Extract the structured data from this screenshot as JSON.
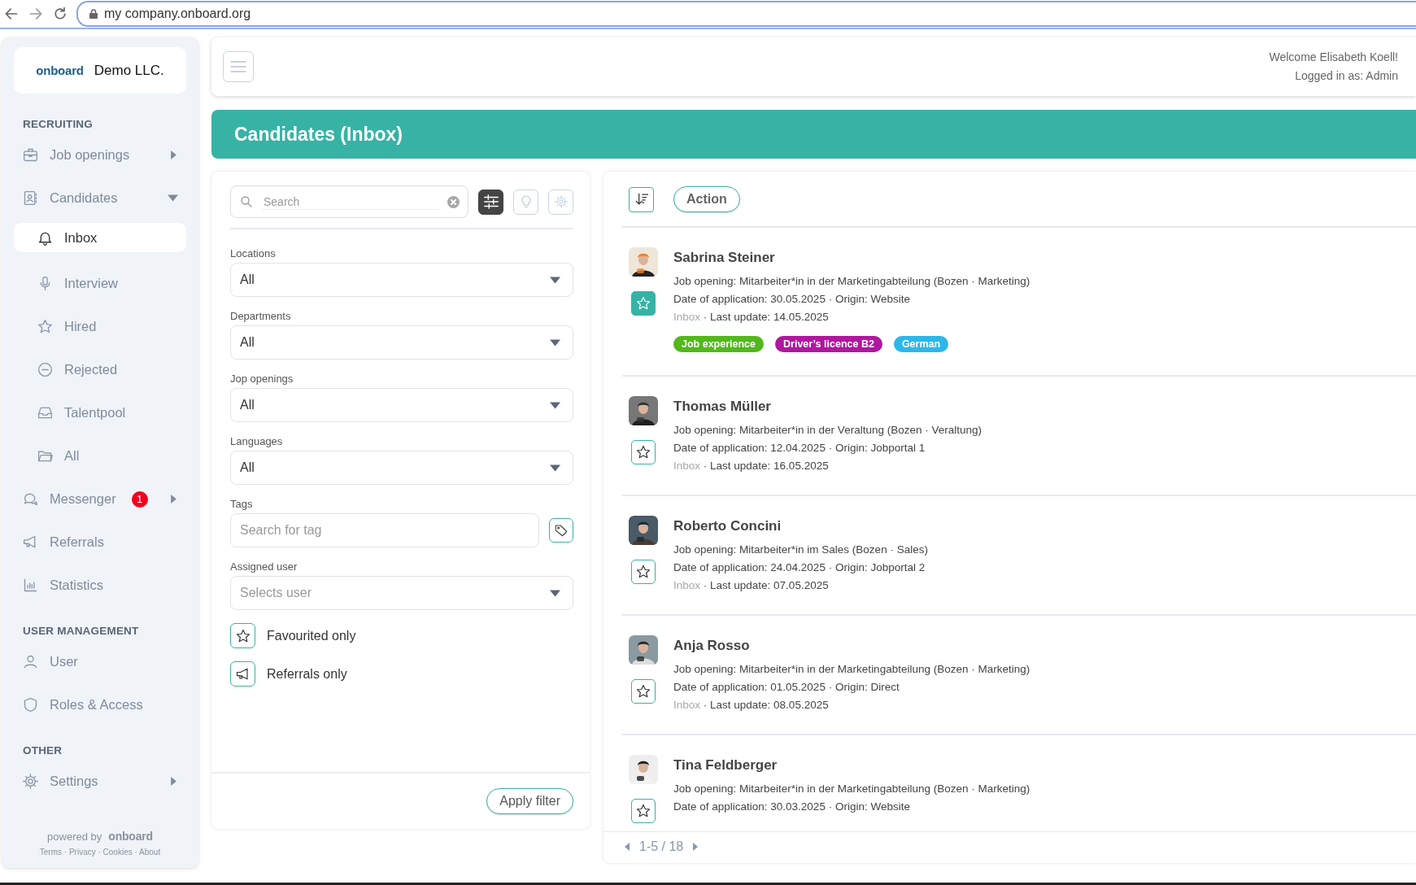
{
  "browser": {
    "url": "my company.onboard.org"
  },
  "sidebar": {
    "logo": "onboard",
    "company": "Demo LLC.",
    "sections": [
      {
        "title": "RECRUITING",
        "items": [
          {
            "label": "Job openings",
            "selected": false,
            "expanded": false
          },
          {
            "label": "Candidates",
            "selected": false,
            "expanded": true,
            "children": [
              {
                "label": "Inbox",
                "selected": true
              },
              {
                "label": "Interview",
                "selected": false
              },
              {
                "label": "Hired",
                "selected": false
              },
              {
                "label": "Rejected",
                "selected": false
              },
              {
                "label": "Talentpool",
                "selected": false
              },
              {
                "label": "All",
                "selected": false
              }
            ]
          },
          {
            "label": "Messenger",
            "selected": false,
            "expanded": false,
            "badge": "1"
          },
          {
            "label": "Referrals",
            "selected": false
          },
          {
            "label": "Statistics",
            "selected": false
          }
        ]
      },
      {
        "title": "USER MANAGEMENT",
        "items": [
          {
            "label": "User",
            "selected": false
          },
          {
            "label": "Roles & Access",
            "selected": false
          }
        ]
      },
      {
        "title": "OTHER",
        "items": [
          {
            "label": "Settings",
            "selected": false,
            "expanded": false
          }
        ]
      }
    ],
    "footer": {
      "powered_by": "powered by",
      "logo": "onboard",
      "links": "Terms · Privacy · Cookies · About"
    }
  },
  "header": {
    "welcome": "Welcome Elisabeth Koell!",
    "role": "Logged in as: Admin"
  },
  "page_title": "Candidates (Inbox)",
  "filters": {
    "search": {
      "placeholder": "Search"
    },
    "filters_open": true,
    "fields": [
      {
        "kind": "select",
        "label": "Locations",
        "value": "All"
      },
      {
        "kind": "select",
        "label": "Departments",
        "value": "All"
      },
      {
        "kind": "select",
        "label": "Jop openings",
        "value": "All"
      },
      {
        "kind": "select",
        "label": "Languages",
        "value": "All"
      },
      {
        "kind": "tag",
        "label": "Tags",
        "placeholder": "Search for tag"
      },
      {
        "kind": "select",
        "label": "Assigned user",
        "placeholder": "Selects user"
      }
    ],
    "toggles": [
      {
        "kind": "favourite",
        "label": "Favourited only",
        "checked": false
      },
      {
        "kind": "referral",
        "label": "Referrals only",
        "checked": false
      }
    ],
    "apply": "Apply filter"
  },
  "candidates": {
    "action": "Action",
    "items": [
      {
        "name": "Sabrina Steiner",
        "job": "Job opening: Mitarbeiter*in in der Marketingabteilung (Bozen · Marketing)",
        "applied": "Date of application: 30.05.2025 · Origin: Website",
        "status": "Inbox",
        "update": "· Last update: 14.05.2025",
        "favourite": true,
        "tags": [
          {
            "label": "Job experience",
            "color": "#52b81c"
          },
          {
            "label": "Driver’s licence B2",
            "color": "#b0179f"
          },
          {
            "label": "German",
            "color": "#2db7e8"
          }
        ]
      },
      {
        "name": "Thomas Müller",
        "job": "Job opening: Mitarbeiter*in in der Veraltung (Bozen · Veraltung)",
        "applied": "Date of application: 12.04.2025 · Origin: Jobportal 1",
        "status": "Inbox",
        "update": "· Last update: 16.05.2025",
        "favourite": false
      },
      {
        "name": "Roberto Concini",
        "job": "Job opening: Mitarbeiter*in im Sales (Bozen · Sales)",
        "applied": "Date of application: 24.04.2025 · Origin: Jobportal 2",
        "status": "Inbox",
        "update": "· Last update: 07.05.2025",
        "favourite": false
      },
      {
        "name": "Anja Rosso",
        "job": "Job opening: Mitarbeiter*in in der Marketingabteilung (Bozen · Marketing)",
        "applied": "Date of application: 01.05.2025 · Origin: Direct",
        "status": "Inbox",
        "update": "· Last update: 08.05.2025",
        "favourite": false
      },
      {
        "name": "Tina Feldberger",
        "job": "Job opening: Mitarbeiter*in in der Marketingabteilung (Bozen · Marketing)",
        "applied": "Date of application: 30.03.2025 · Origin: Website",
        "favourite": false
      }
    ],
    "pagination": "1-5 / 18"
  }
}
